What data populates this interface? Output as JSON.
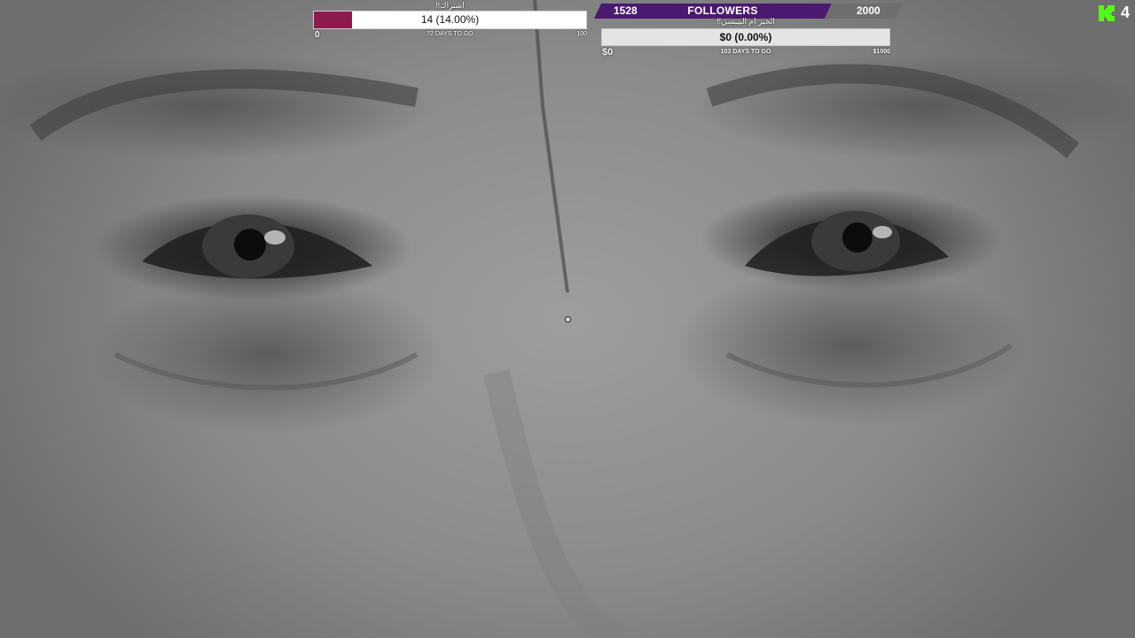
{
  "goal_left": {
    "title": "!!اشتراك",
    "progress_text": "14 (14.00%)",
    "progress_fraction": 0.14,
    "min_label": "0",
    "days_label": "72 DAYS TO GO",
    "max_label": "100",
    "fill_color": "#8e1a4c"
  },
  "followers": {
    "current": "1528",
    "label": "FOLLOWERS",
    "target": "2000",
    "progress_fraction": 0.764,
    "fill_color": "#4a1a6e"
  },
  "goal_right": {
    "title": "!!الخير ام البيبسي",
    "progress_text": "$0 (0.00%)",
    "progress_fraction": 0.0,
    "min_label": "$0",
    "days_label": "103 DAYS TO GO",
    "max_label": "$1000"
  },
  "kick": {
    "logo_icon": "kick-logo-icon",
    "logo_color": "#53fc18",
    "count": "4"
  }
}
